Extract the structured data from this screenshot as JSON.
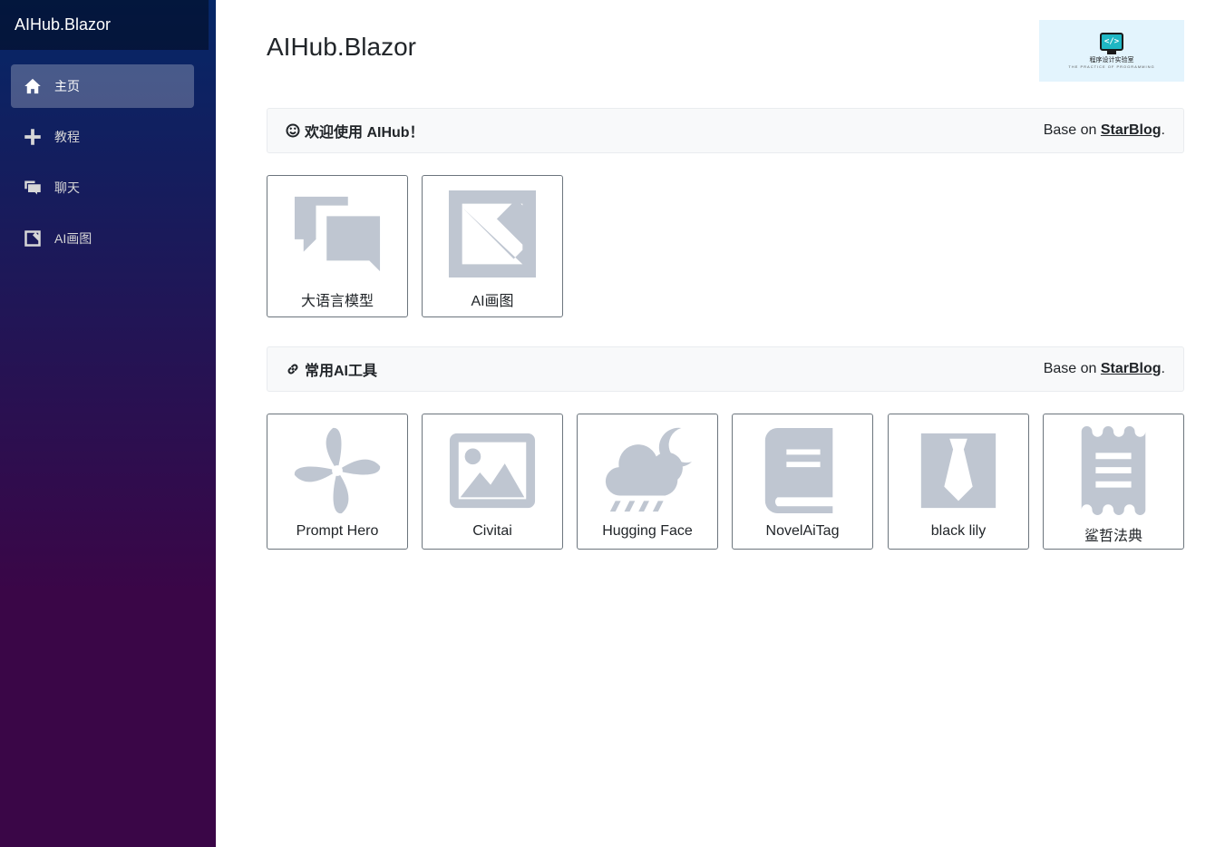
{
  "sidebar": {
    "brand": "AIHub.Blazor",
    "items": [
      {
        "label": "主页",
        "icon": "home-icon"
      },
      {
        "label": "教程",
        "icon": "plus-icon"
      },
      {
        "label": "聊天",
        "icon": "chat-icon"
      },
      {
        "label": "AI画图",
        "icon": "image-icon"
      }
    ]
  },
  "header": {
    "title": "AIHub.Blazor",
    "logo_text": "程序设计实验室",
    "logo_sub": "THE PRACTICE OF PROGRAMMING"
  },
  "sections": [
    {
      "title": "欢迎使用 AIHub！",
      "icon": "smile-icon",
      "base_on_prefix": "Base on ",
      "base_on_link": "StarBlog",
      "base_on_suffix": ".",
      "cards": [
        {
          "label": "大语言模型",
          "icon": "chat-bubbles-icon"
        },
        {
          "label": "AI画图",
          "icon": "image-icon"
        }
      ]
    },
    {
      "title": "常用AI工具",
      "icon": "link-icon",
      "base_on_prefix": "Base on ",
      "base_on_link": "StarBlog",
      "base_on_suffix": ".",
      "cards": [
        {
          "label": "Prompt Hero",
          "icon": "pinwheel-icon"
        },
        {
          "label": "Civitai",
          "icon": "picture-icon"
        },
        {
          "label": "Hugging Face",
          "icon": "cloud-moon-rain-icon"
        },
        {
          "label": "NovelAiTag",
          "icon": "book-icon"
        },
        {
          "label": "black lily",
          "icon": "tie-icon"
        },
        {
          "label": "鲨哲法典",
          "icon": "receipt-icon"
        }
      ]
    }
  ],
  "colors": {
    "sidebar_top": "#052767",
    "sidebar_bottom": "#3a0647",
    "icon_gray": "#bfc6d1",
    "header_bg": "#f8f9fa",
    "logo_bg": "#e3f4fd"
  }
}
